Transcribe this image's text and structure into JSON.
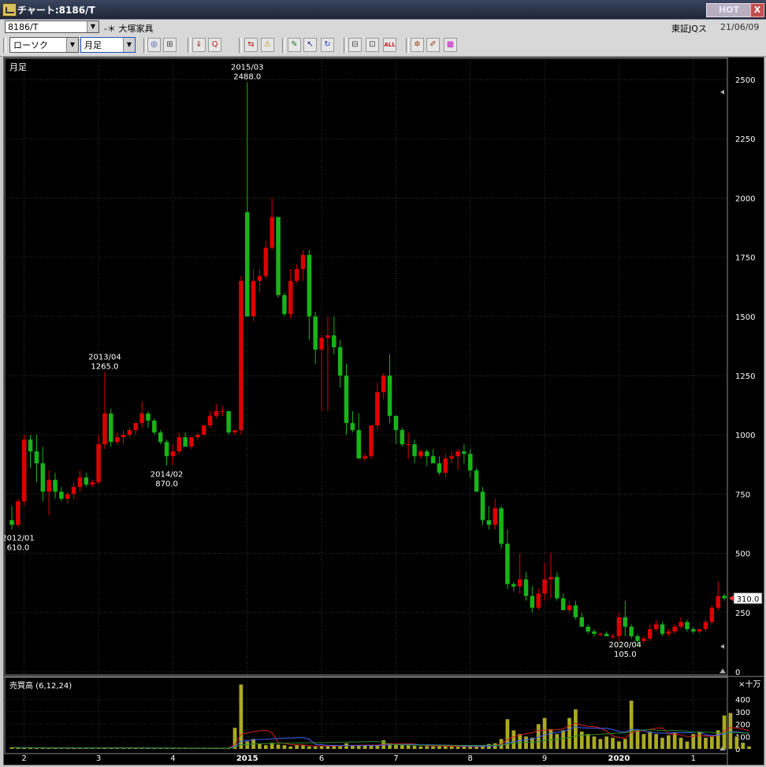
{
  "window": {
    "title": "チャート:8186/T",
    "hot_label": "HOT",
    "close_label": "X"
  },
  "header": {
    "code": "8186/T",
    "name": "-＊ 大塚家具",
    "exchange": "東証JQス",
    "date": "21/06/09"
  },
  "controls": {
    "chart_type": "ローソク",
    "period": "月足"
  },
  "toolbar": [
    {
      "name": "zoom-icon",
      "glyph": "◎",
      "color": "#2040a0"
    },
    {
      "name": "measure-icon",
      "glyph": "⊞",
      "color": "#404040"
    },
    {
      "name": "down-icon",
      "glyph": "⇓",
      "color": "#a02020"
    },
    {
      "name": "search-q-icon",
      "glyph": "Q",
      "color": "#c02020"
    },
    {
      "name": "compare-icon",
      "glyph": "⇆",
      "color": "#c02020"
    },
    {
      "name": "warning-icon",
      "glyph": "⚠",
      "color": "#c09000"
    },
    {
      "name": "pen-icon",
      "glyph": "✎",
      "color": "#208020"
    },
    {
      "name": "cursor-icon",
      "glyph": "↖",
      "color": "#202080"
    },
    {
      "name": "redo-icon",
      "glyph": "↻",
      "color": "#2040c0"
    },
    {
      "name": "candle-expand-icon",
      "glyph": "⊟",
      "color": "#404040"
    },
    {
      "name": "candle-shrink-icon",
      "glyph": "⊡",
      "color": "#404040"
    },
    {
      "name": "all-icon",
      "glyph": "ALL",
      "color": "#c02020"
    },
    {
      "name": "settings-icon",
      "glyph": "✲",
      "color": "#a04010"
    },
    {
      "name": "wrench-icon",
      "glyph": "✐",
      "color": "#a04010"
    },
    {
      "name": "palette-icon",
      "glyph": "▦",
      "color": "#c020c0"
    }
  ],
  "colors": {
    "up": "#dd0000",
    "down": "#18b418",
    "volume": "#aaaa22",
    "ma6": "#d82020",
    "ma12": "#4060ff",
    "ma24": "#2a8a2a",
    "current_tag_bg": "#ffffff"
  },
  "chart_data": {
    "type": "candlestick",
    "period_label": "月足",
    "y_ticks": [
      0,
      250,
      500,
      750,
      1000,
      1250,
      1500,
      1750,
      2000,
      2250,
      2500
    ],
    "ylim": [
      0,
      2560
    ],
    "x_tick_labels": [
      {
        "label": "2",
        "index": 2
      },
      {
        "label": "3",
        "index": 14
      },
      {
        "label": "4",
        "index": 26
      },
      {
        "label": "2015",
        "index": 38
      },
      {
        "label": "6",
        "index": 50
      },
      {
        "label": "7",
        "index": 62
      },
      {
        "label": "8",
        "index": 74
      },
      {
        "label": "9",
        "index": 86
      },
      {
        "label": "2020",
        "index": 98
      },
      {
        "label": "1",
        "index": 110
      }
    ],
    "ohlc": [
      [
        640,
        700,
        600,
        620
      ],
      [
        620,
        730,
        610,
        720
      ],
      [
        720,
        1000,
        700,
        980
      ],
      [
        980,
        1000,
        860,
        930
      ],
      [
        930,
        1000,
        800,
        880
      ],
      [
        880,
        950,
        720,
        760
      ],
      [
        760,
        850,
        660,
        810
      ],
      [
        810,
        840,
        730,
        760
      ],
      [
        760,
        780,
        720,
        730
      ],
      [
        730,
        760,
        710,
        750
      ],
      [
        750,
        800,
        730,
        780
      ],
      [
        780,
        850,
        760,
        820
      ],
      [
        820,
        840,
        780,
        790
      ],
      [
        790,
        810,
        780,
        800
      ],
      [
        800,
        1000,
        790,
        960
      ],
      [
        960,
        1265,
        940,
        1090
      ],
      [
        1090,
        1110,
        950,
        970
      ],
      [
        970,
        1010,
        960,
        990
      ],
      [
        990,
        1020,
        960,
        1000
      ],
      [
        1000,
        1030,
        990,
        1020
      ],
      [
        1020,
        1050,
        1000,
        1050
      ],
      [
        1050,
        1140,
        1030,
        1090
      ],
      [
        1090,
        1100,
        1030,
        1060
      ],
      [
        1060,
        1070,
        1000,
        1010
      ],
      [
        1010,
        1020,
        960,
        970
      ],
      [
        970,
        980,
        870,
        910
      ],
      [
        910,
        960,
        870,
        930
      ],
      [
        930,
        1010,
        920,
        990
      ],
      [
        990,
        1010,
        960,
        950
      ],
      [
        950,
        990,
        940,
        990
      ],
      [
        990,
        1010,
        980,
        1000
      ],
      [
        1000,
        1040,
        1000,
        1040
      ],
      [
        1040,
        1100,
        1030,
        1080
      ],
      [
        1080,
        1130,
        1070,
        1100
      ],
      [
        1100,
        1120,
        1080,
        1100
      ],
      [
        1100,
        1100,
        1000,
        1010
      ],
      [
        1010,
        1020,
        1000,
        1020
      ],
      [
        1020,
        1670,
        1000,
        1650
      ],
      [
        1940,
        2488,
        1500,
        1500
      ],
      [
        1500,
        1700,
        1480,
        1650
      ],
      [
        1650,
        1700,
        1600,
        1670
      ],
      [
        1670,
        1820,
        1660,
        1790
      ],
      [
        1790,
        2000,
        1780,
        1920
      ],
      [
        1920,
        1920,
        1580,
        1590
      ],
      [
        1590,
        1600,
        1500,
        1510
      ],
      [
        1510,
        1700,
        1490,
        1650
      ],
      [
        1650,
        1720,
        1640,
        1700
      ],
      [
        1700,
        1780,
        1650,
        1760
      ],
      [
        1760,
        1780,
        1400,
        1500
      ],
      [
        1500,
        1520,
        1300,
        1360
      ],
      [
        1360,
        1420,
        1100,
        1410
      ],
      [
        1410,
        1500,
        1100,
        1420
      ],
      [
        1420,
        1500,
        1340,
        1370
      ],
      [
        1370,
        1400,
        1200,
        1250
      ],
      [
        1250,
        1300,
        1000,
        1050
      ],
      [
        1050,
        1100,
        1010,
        1020
      ],
      [
        1020,
        1090,
        1000,
        900
      ],
      [
        900,
        920,
        890,
        910
      ],
      [
        910,
        1030,
        900,
        1040
      ],
      [
        1040,
        1220,
        1020,
        1180
      ],
      [
        1180,
        1260,
        1150,
        1250
      ],
      [
        1250,
        1340,
        1050,
        1080
      ],
      [
        1080,
        1080,
        960,
        1020
      ],
      [
        1020,
        1030,
        950,
        960
      ],
      [
        960,
        1010,
        900,
        960
      ],
      [
        960,
        980,
        880,
        910
      ],
      [
        910,
        940,
        900,
        930
      ],
      [
        930,
        940,
        870,
        910
      ],
      [
        910,
        940,
        890,
        880
      ],
      [
        880,
        910,
        830,
        840
      ],
      [
        840,
        920,
        820,
        900
      ],
      [
        900,
        930,
        880,
        910
      ],
      [
        910,
        940,
        850,
        930
      ],
      [
        930,
        960,
        880,
        920
      ],
      [
        920,
        940,
        820,
        850
      ],
      [
        850,
        860,
        760,
        760
      ],
      [
        760,
        780,
        620,
        640
      ],
      [
        640,
        700,
        600,
        620
      ],
      [
        620,
        730,
        600,
        690
      ],
      [
        690,
        700,
        520,
        540
      ],
      [
        540,
        600,
        350,
        370
      ],
      [
        370,
        380,
        340,
        360
      ],
      [
        360,
        500,
        330,
        390
      ],
      [
        390,
        420,
        300,
        320
      ],
      [
        320,
        360,
        250,
        270
      ],
      [
        270,
        350,
        260,
        330
      ],
      [
        330,
        460,
        300,
        390
      ],
      [
        390,
        500,
        310,
        400
      ],
      [
        400,
        420,
        300,
        310
      ],
      [
        310,
        330,
        260,
        260
      ],
      [
        260,
        300,
        250,
        280
      ],
      [
        280,
        300,
        220,
        230
      ],
      [
        230,
        250,
        200,
        190
      ],
      [
        190,
        200,
        160,
        170
      ],
      [
        170,
        180,
        150,
        160
      ],
      [
        160,
        165,
        150,
        160
      ],
      [
        160,
        170,
        150,
        150
      ],
      [
        150,
        160,
        140,
        150
      ],
      [
        150,
        250,
        130,
        230
      ],
      [
        230,
        300,
        150,
        190
      ],
      [
        190,
        200,
        140,
        150
      ],
      [
        150,
        160,
        105,
        130
      ],
      [
        130,
        150,
        120,
        140
      ],
      [
        140,
        200,
        130,
        180
      ],
      [
        180,
        220,
        170,
        200
      ],
      [
        200,
        210,
        150,
        160
      ],
      [
        160,
        180,
        150,
        170
      ],
      [
        170,
        200,
        160,
        190
      ],
      [
        190,
        230,
        180,
        210
      ],
      [
        210,
        220,
        170,
        180
      ],
      [
        180,
        190,
        160,
        170
      ],
      [
        170,
        180,
        160,
        180
      ],
      [
        180,
        220,
        170,
        210
      ],
      [
        210,
        280,
        200,
        270
      ],
      [
        270,
        380,
        260,
        320
      ],
      [
        320,
        330,
        300,
        310
      ]
    ],
    "annotations": [
      {
        "index": 0,
        "date": "2012/01",
        "value": "610.0",
        "pos": "below"
      },
      {
        "index": 15,
        "date": "2013/04",
        "value": "1265.0",
        "pos": "above"
      },
      {
        "index": 25,
        "date": "2014/02",
        "value": "870.0",
        "pos": "below"
      },
      {
        "index": 38,
        "date": "2015/03",
        "value": "2488.0",
        "pos": "above"
      },
      {
        "index": 99,
        "date": "2020/04",
        "value": "105.0",
        "pos": "below"
      }
    ],
    "current_price": "310.0",
    "volume_panel": {
      "label": "売買高 (6,12,24)",
      "unit": "×十万",
      "y_ticks": [
        0,
        100,
        200,
        300,
        400
      ],
      "ylim": [
        0,
        560
      ],
      "values": [
        12,
        10,
        8,
        9,
        7,
        6,
        8,
        6,
        5,
        7,
        6,
        8,
        6,
        5,
        9,
        12,
        10,
        6,
        5,
        6,
        6,
        8,
        7,
        5,
        5,
        8,
        6,
        5,
        6,
        5,
        5,
        6,
        6,
        7,
        5,
        6,
        170,
        520,
        60,
        80,
        45,
        30,
        50,
        35,
        30,
        20,
        30,
        28,
        20,
        18,
        25,
        20,
        30,
        25,
        45,
        25,
        30,
        28,
        30,
        30,
        70,
        45,
        40,
        30,
        28,
        25,
        20,
        22,
        20,
        25,
        22,
        20,
        18,
        18,
        20,
        18,
        30,
        40,
        45,
        80,
        240,
        150,
        120,
        100,
        90,
        200,
        250,
        160,
        120,
        150,
        250,
        320,
        140,
        120,
        100,
        80,
        100,
        90,
        60,
        80,
        390,
        150,
        120,
        140,
        120,
        90,
        110,
        130,
        90,
        60,
        120,
        140,
        90,
        100,
        150,
        270,
        290,
        100,
        50,
        20
      ]
    }
  }
}
